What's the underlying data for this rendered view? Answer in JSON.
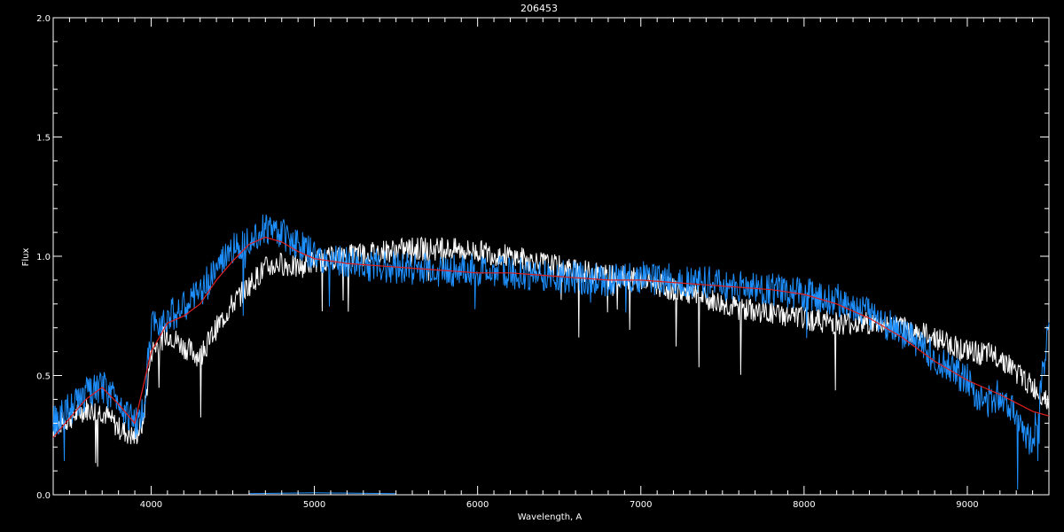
{
  "chart_data": {
    "type": "line",
    "title": "206453",
    "xlabel": "Wavelength, A",
    "ylabel": "Flux",
    "xlim": [
      3400,
      9500
    ],
    "ylim": [
      0.0,
      2.0
    ],
    "x_ticks": [
      4000,
      5000,
      6000,
      7000,
      8000,
      9000
    ],
    "y_ticks": [
      0.0,
      0.5,
      1.0,
      1.5,
      2.0
    ],
    "y_tick_labels": [
      "0.0",
      "0.5",
      "1.0",
      "1.5",
      "2.0"
    ],
    "grid": false,
    "colors": {
      "background": "#000000",
      "axes": "#ffffff",
      "white_series": "#ffffff",
      "blue_series": "#1e90ff",
      "red_series": "#e02020"
    },
    "series": [
      {
        "color": "white",
        "x": [
          3400,
          3500,
          3600,
          3700,
          3800,
          3900,
          3950,
          4000,
          4100,
          4200,
          4300,
          4400,
          4500,
          4600,
          4700,
          4800,
          4900,
          5000,
          5200,
          5400,
          5600,
          5800,
          6000,
          6200,
          6400,
          6600,
          6800,
          7000,
          7200,
          7400,
          7600,
          7800,
          8000,
          8200,
          8400,
          8600,
          8800,
          9000,
          9200,
          9400,
          9500
        ],
        "y": [
          0.28,
          0.32,
          0.36,
          0.35,
          0.28,
          0.24,
          0.3,
          0.6,
          0.68,
          0.62,
          0.58,
          0.7,
          0.8,
          0.88,
          0.95,
          0.97,
          0.95,
          0.98,
          1.0,
          1.02,
          1.03,
          1.03,
          1.02,
          1.0,
          0.97,
          0.94,
          0.92,
          0.9,
          0.86,
          0.82,
          0.78,
          0.76,
          0.74,
          0.72,
          0.72,
          0.7,
          0.66,
          0.6,
          0.58,
          0.45,
          0.4
        ]
      },
      {
        "color": "blue",
        "x": [
          3400,
          3500,
          3600,
          3700,
          3800,
          3900,
          3950,
          4000,
          4100,
          4200,
          4300,
          4400,
          4500,
          4600,
          4700,
          4800,
          4900,
          5000,
          5200,
          5400,
          5600,
          5800,
          6000,
          6200,
          6400,
          6600,
          6800,
          7000,
          7200,
          7400,
          7600,
          7800,
          8000,
          8200,
          8400,
          8600,
          8800,
          9000,
          9100,
          9200,
          9300,
          9400,
          9500
        ],
        "y": [
          0.3,
          0.36,
          0.42,
          0.45,
          0.4,
          0.3,
          0.34,
          0.7,
          0.75,
          0.78,
          0.85,
          0.95,
          1.03,
          1.08,
          1.12,
          1.1,
          1.05,
          1.0,
          0.97,
          0.96,
          0.95,
          0.94,
          0.94,
          0.93,
          0.92,
          0.91,
          0.9,
          0.91,
          0.9,
          0.89,
          0.87,
          0.86,
          0.84,
          0.82,
          0.76,
          0.68,
          0.58,
          0.48,
          0.38,
          0.42,
          0.35,
          0.2,
          0.7
        ]
      },
      {
        "color": "red",
        "x": [
          3400,
          3500,
          3600,
          3700,
          3800,
          3900,
          4000,
          4100,
          4200,
          4300,
          4400,
          4500,
          4600,
          4700,
          4800,
          4900,
          5000,
          5200,
          5400,
          5600,
          5800,
          6000,
          6200,
          6400,
          6600,
          6800,
          7000,
          7200,
          7400,
          7600,
          7800,
          8000,
          8200,
          8400,
          8600,
          8800,
          9000,
          9200,
          9400,
          9500
        ],
        "y": [
          0.24,
          0.32,
          0.4,
          0.45,
          0.38,
          0.3,
          0.6,
          0.72,
          0.75,
          0.8,
          0.9,
          0.98,
          1.05,
          1.08,
          1.06,
          1.02,
          0.99,
          0.97,
          0.96,
          0.95,
          0.94,
          0.93,
          0.93,
          0.92,
          0.91,
          0.9,
          0.9,
          0.89,
          0.88,
          0.87,
          0.86,
          0.84,
          0.8,
          0.74,
          0.66,
          0.56,
          0.48,
          0.42,
          0.35,
          0.33
        ]
      },
      {
        "color": "blue",
        "x": [
          4600,
          5000,
          5500
        ],
        "y": [
          0.005,
          0.008,
          0.005
        ]
      }
    ]
  }
}
